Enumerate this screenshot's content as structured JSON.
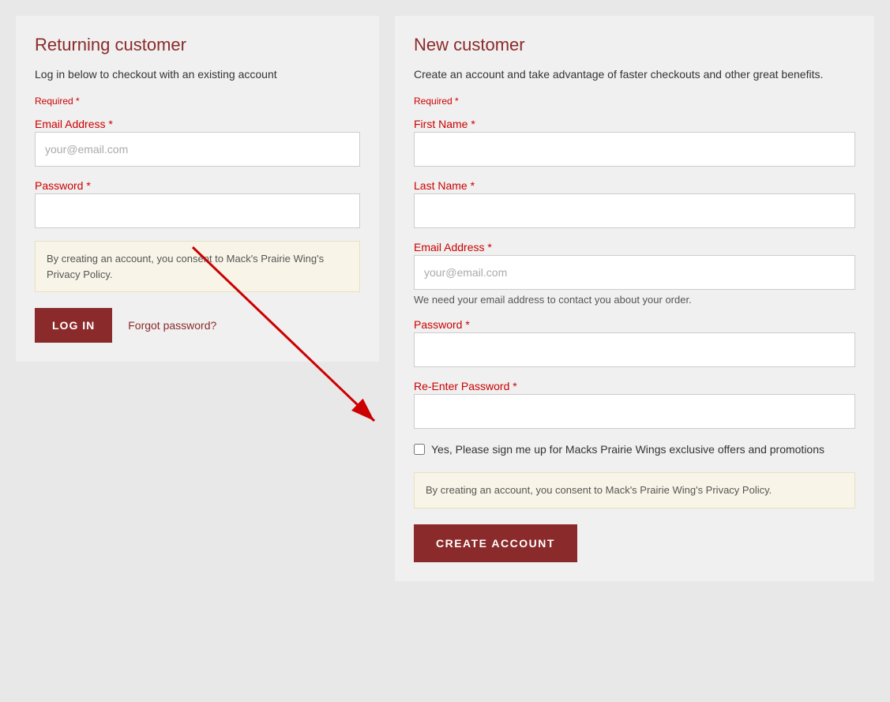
{
  "left_panel": {
    "title": "Returning customer",
    "subtitle": "Log in below to checkout with an existing account",
    "required_label": "Required",
    "email_label": "Email Address",
    "email_placeholder": "your@email.com",
    "password_label": "Password",
    "consent_text": "By creating an account, you consent to Mack's Prairie Wing's Privacy Policy.",
    "login_button": "LOG IN",
    "forgot_link": "Forgot password?"
  },
  "right_panel": {
    "title": "New customer",
    "subtitle": "Create an account and take advantage of faster checkouts and other great benefits.",
    "required_label": "Required",
    "first_name_label": "First Name",
    "last_name_label": "Last Name",
    "email_label": "Email Address",
    "email_placeholder": "your@email.com",
    "email_hint": "We need your email address to contact you about your order.",
    "password_label": "Password",
    "reenter_password_label": "Re-Enter Password",
    "newsletter_label": "Yes, Please sign me up for Macks Prairie Wings exclusive offers and promotions",
    "consent_text": "By creating an account, you consent to Mack's Prairie Wing's Privacy Policy.",
    "create_button": "CREATE ACCOUNT"
  }
}
